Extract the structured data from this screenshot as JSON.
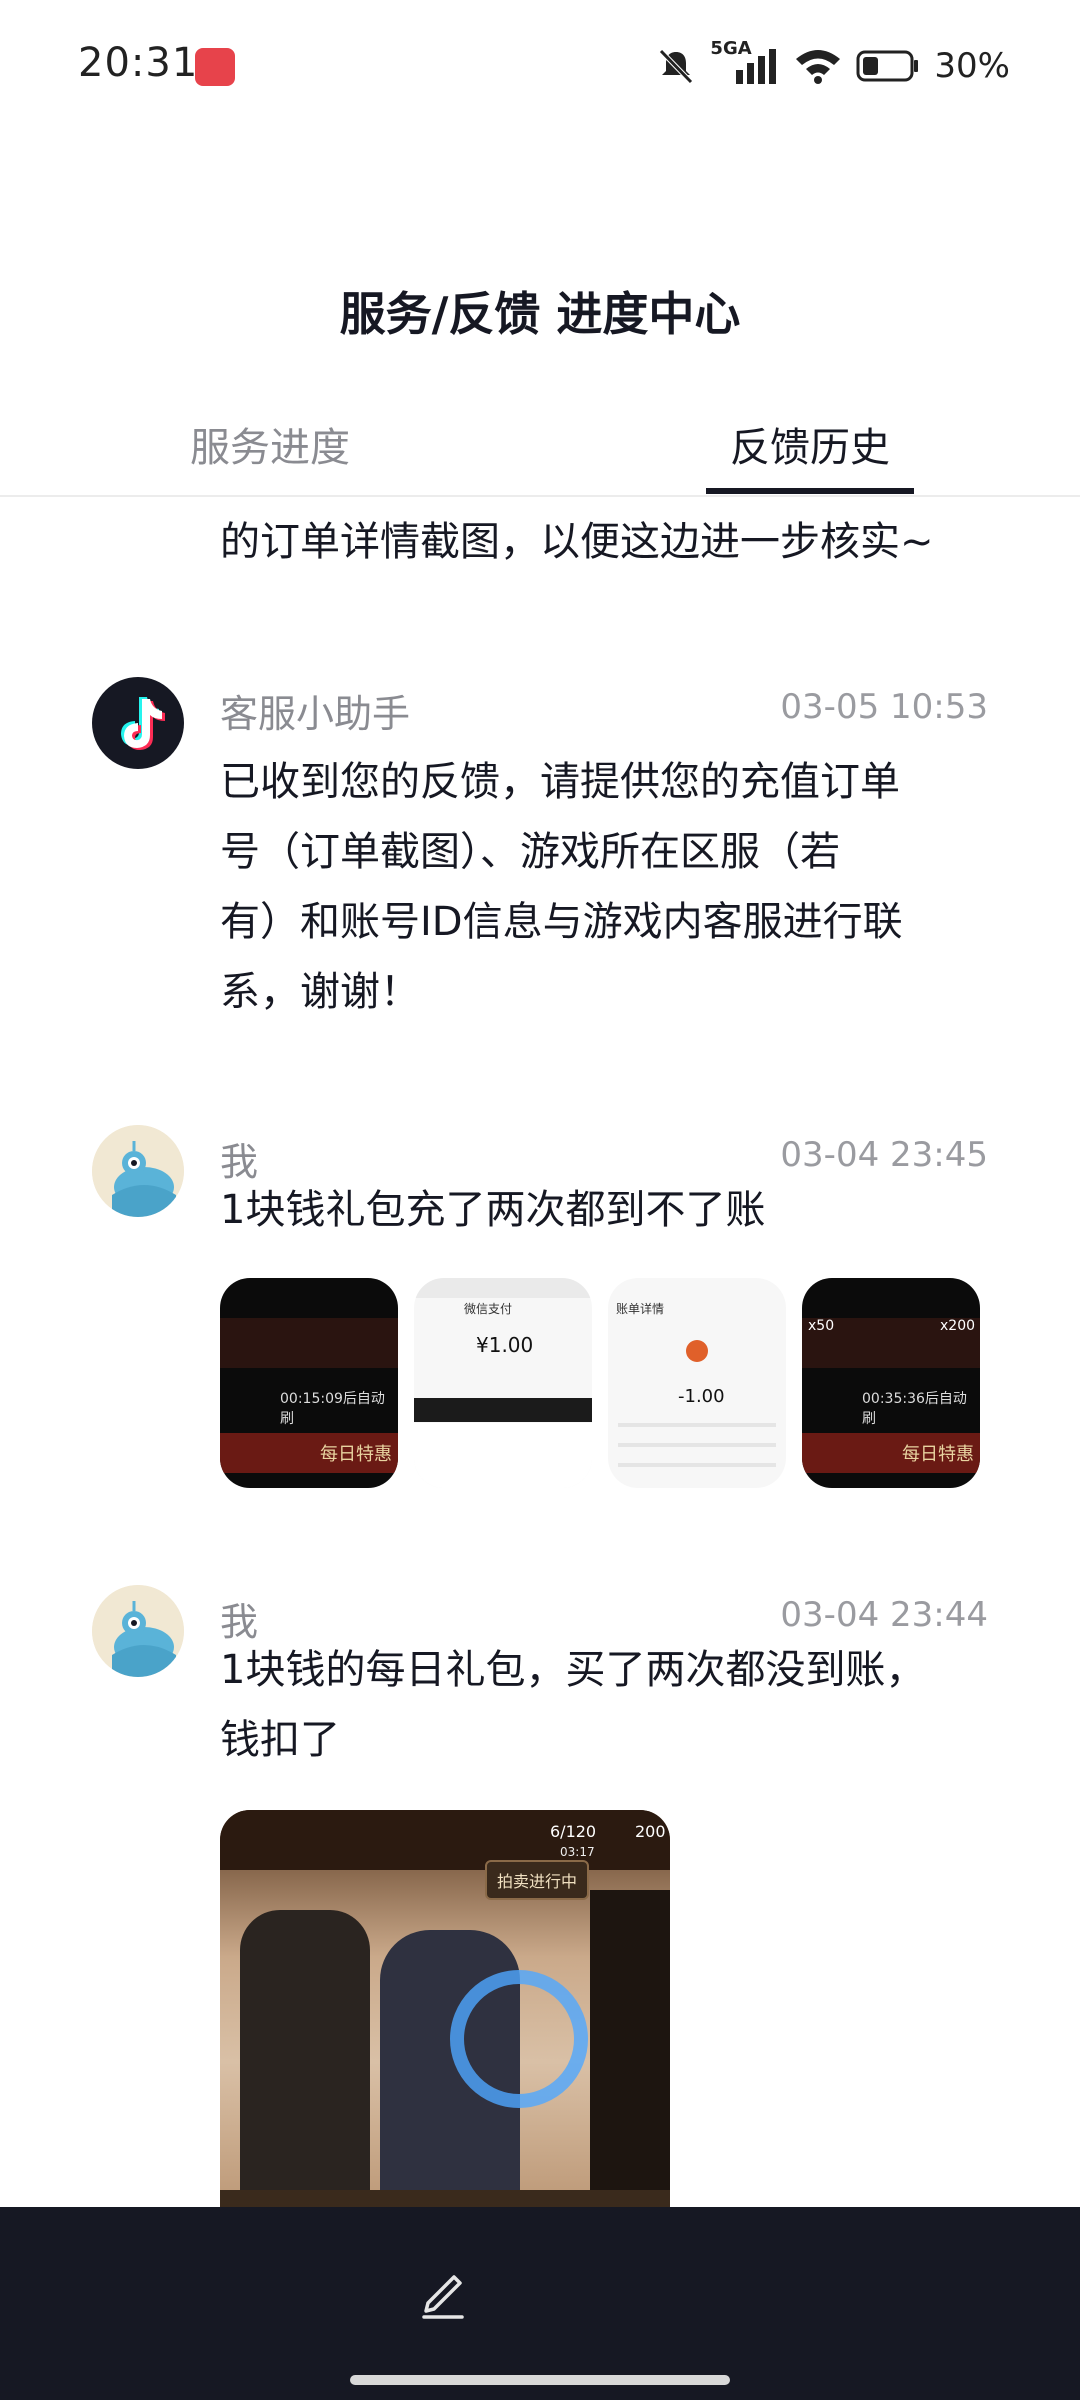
{
  "status_bar": {
    "time": "20:31",
    "network": "5GA",
    "battery": "30%"
  },
  "header": {
    "title": "服务/反馈 进度中心"
  },
  "tabs": [
    {
      "label": "服务进度",
      "active": false
    },
    {
      "label": "反馈历史",
      "active": true
    }
  ],
  "messages": [
    {
      "partial_text": "的订单详情截图，以便这边进一步核实~"
    },
    {
      "sender": "客服小助手",
      "time": "03-05 10:53",
      "text_lines": [
        "已收到您的反馈，请提供您的充值订单",
        "号（订单截图）、游戏所在区服（若",
        "有）和账号ID信息与游戏内客服进行联",
        "系，谢谢！"
      ]
    },
    {
      "sender": "我",
      "time": "03-04 23:45",
      "text": "1块钱礼包充了两次都到不了账",
      "thumbs": [
        {
          "caption_a": "00:15:09后自动刷",
          "caption_b": "每日特惠"
        },
        {
          "amount": "¥1.00",
          "title": "微信支付"
        },
        {
          "amount": "-1.00",
          "title": "账单详情"
        },
        {
          "caption_a": "00:35:36后自动刷",
          "caption_b": "每日特惠",
          "badge_a": "x50",
          "badge_b": "x200"
        }
      ]
    },
    {
      "sender": "我",
      "time": "03-04 23:44",
      "text_lines": [
        "1块钱的每日礼包，买了两次都没到账，",
        "钱扣了"
      ],
      "image": {
        "counter": "6/120",
        "timer": "03:17",
        "coins": "200",
        "banner": "拍卖进行中"
      }
    }
  ],
  "bottom_bar": {
    "icon": "edit-icon"
  }
}
